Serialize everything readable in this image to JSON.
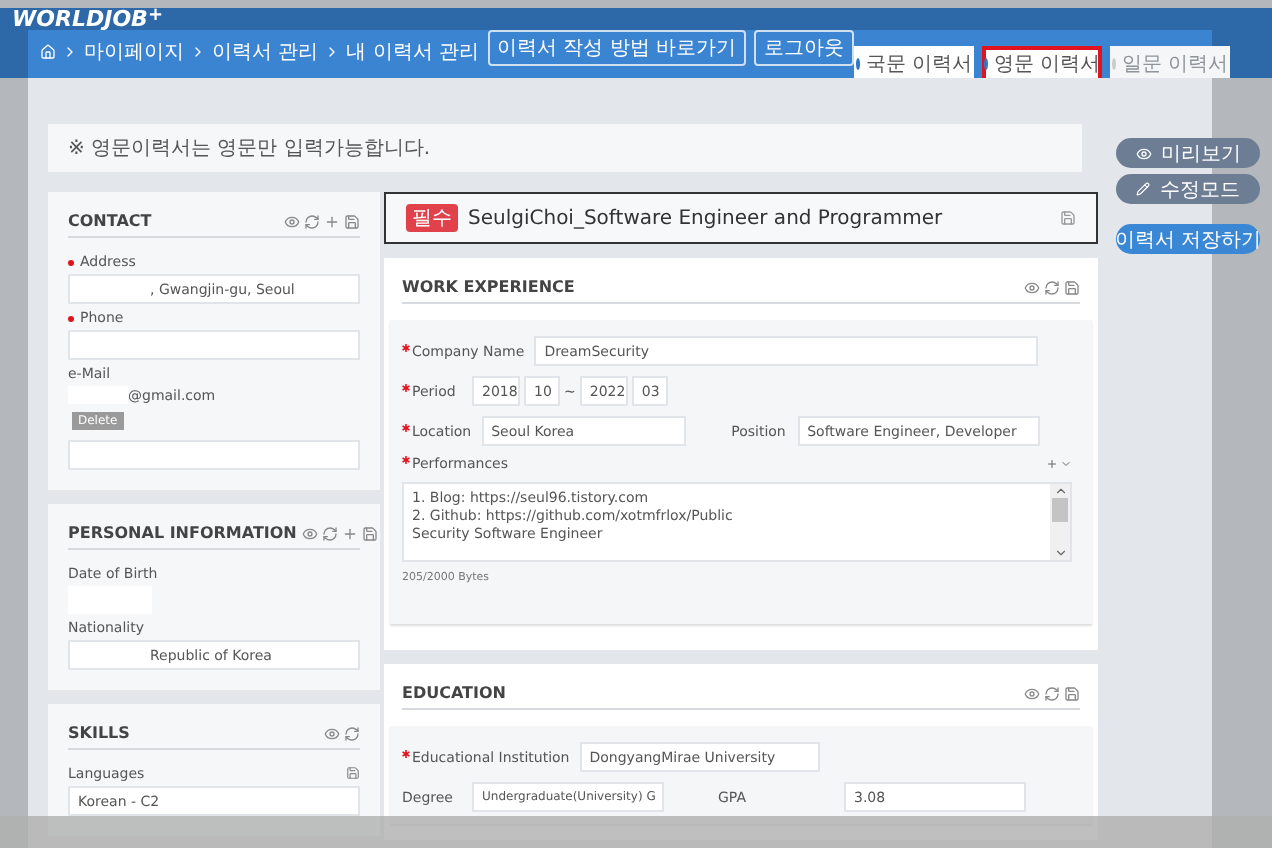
{
  "header": {
    "logo": "WORLDJOB",
    "logo_mark": "+",
    "breadcrumb": [
      "마이페이지",
      "이력서 관리",
      "내 이력서 관리"
    ],
    "buttons": [
      "이력서 작성 방법 바로가기",
      "로그아웃"
    ],
    "tabs": [
      {
        "label": "국문 이력서",
        "selected": false,
        "disabled": false
      },
      {
        "label": "영문 이력서",
        "selected": true,
        "disabled": false
      },
      {
        "label": "일문 이력서",
        "selected": false,
        "disabled": true
      }
    ]
  },
  "notice": "※ 영문이력서는 영문만 입력가능합니다.",
  "left_panels": [
    {
      "title": "CONTACT",
      "addable": true,
      "savable": true,
      "fields": [
        {
          "kind": "input",
          "label": "Address",
          "required": true,
          "value": ", Gwangjin-gu, Seoul"
        },
        {
          "kind": "input",
          "label": "Phone",
          "required": true
        },
        {
          "kind": "text",
          "label": "e-Mail",
          "required": false,
          "value": "@gmail.com",
          "action": "Delete"
        },
        {
          "kind": "input"
        }
      ]
    },
    {
      "title": "PERSONAL INFORMATION",
      "addable": true,
      "savable": true,
      "fields": [
        {
          "kind": "blank",
          "label": "Date of Birth",
          "required": false
        },
        {
          "kind": "input",
          "label": "Nationality",
          "required": false,
          "value": "Republic of Korea"
        }
      ]
    },
    {
      "title": "SKILLS",
      "addable": false,
      "savable": false,
      "fields": [
        {
          "kind": "saveinput",
          "label": "Languages",
          "required": false,
          "value": "Korean - C2"
        }
      ]
    }
  ],
  "title_bar": {
    "badge": "필수",
    "title": "SeulgiChoi_Software Engineer and Programmer"
  },
  "sections": [
    {
      "title": "WORK EXPERIENCE",
      "addable": false,
      "savable": true,
      "fields": [
        {
          "kind": "input",
          "label": "Company Name",
          "required": true,
          "value": "DreamSecurity"
        },
        {
          "kind": "period",
          "label": "Period",
          "required": true,
          "start": [
            "2018",
            "10"
          ],
          "separator": "~",
          "end": [
            "2022",
            "03"
          ]
        },
        {
          "kind": "pair",
          "label": "Location",
          "required": true,
          "value": "Seoul Korea",
          "label_2": "Position",
          "value_2": "Software Engineer, Developer"
        },
        {
          "kind": "textarea",
          "label": "Performances",
          "required": true,
          "lines": [
            "1. Blog: https://seul96.tistory.com",
            "2. Github: https://github.com/xotmfrlox/Public",
            "Security Software Engineer"
          ],
          "counter": "205/2000 Bytes"
        }
      ]
    },
    {
      "title": "EDUCATION",
      "addable": false,
      "savable": true,
      "fields": [
        {
          "kind": "input",
          "label": "Educational Institution",
          "required": true,
          "value": "DongyangMirae University"
        },
        {
          "kind": "selectpair",
          "label": "Degree",
          "required": false,
          "value": "Undergraduate(University) G",
          "label_2": "GPA",
          "value_2": "3.08"
        }
      ]
    }
  ],
  "side_buttons": [
    {
      "kind": "preview",
      "label": "미리보기"
    },
    {
      "kind": "edit",
      "label": "수정모드"
    },
    {
      "kind": "primary",
      "label": "이력서 저장하기"
    }
  ]
}
